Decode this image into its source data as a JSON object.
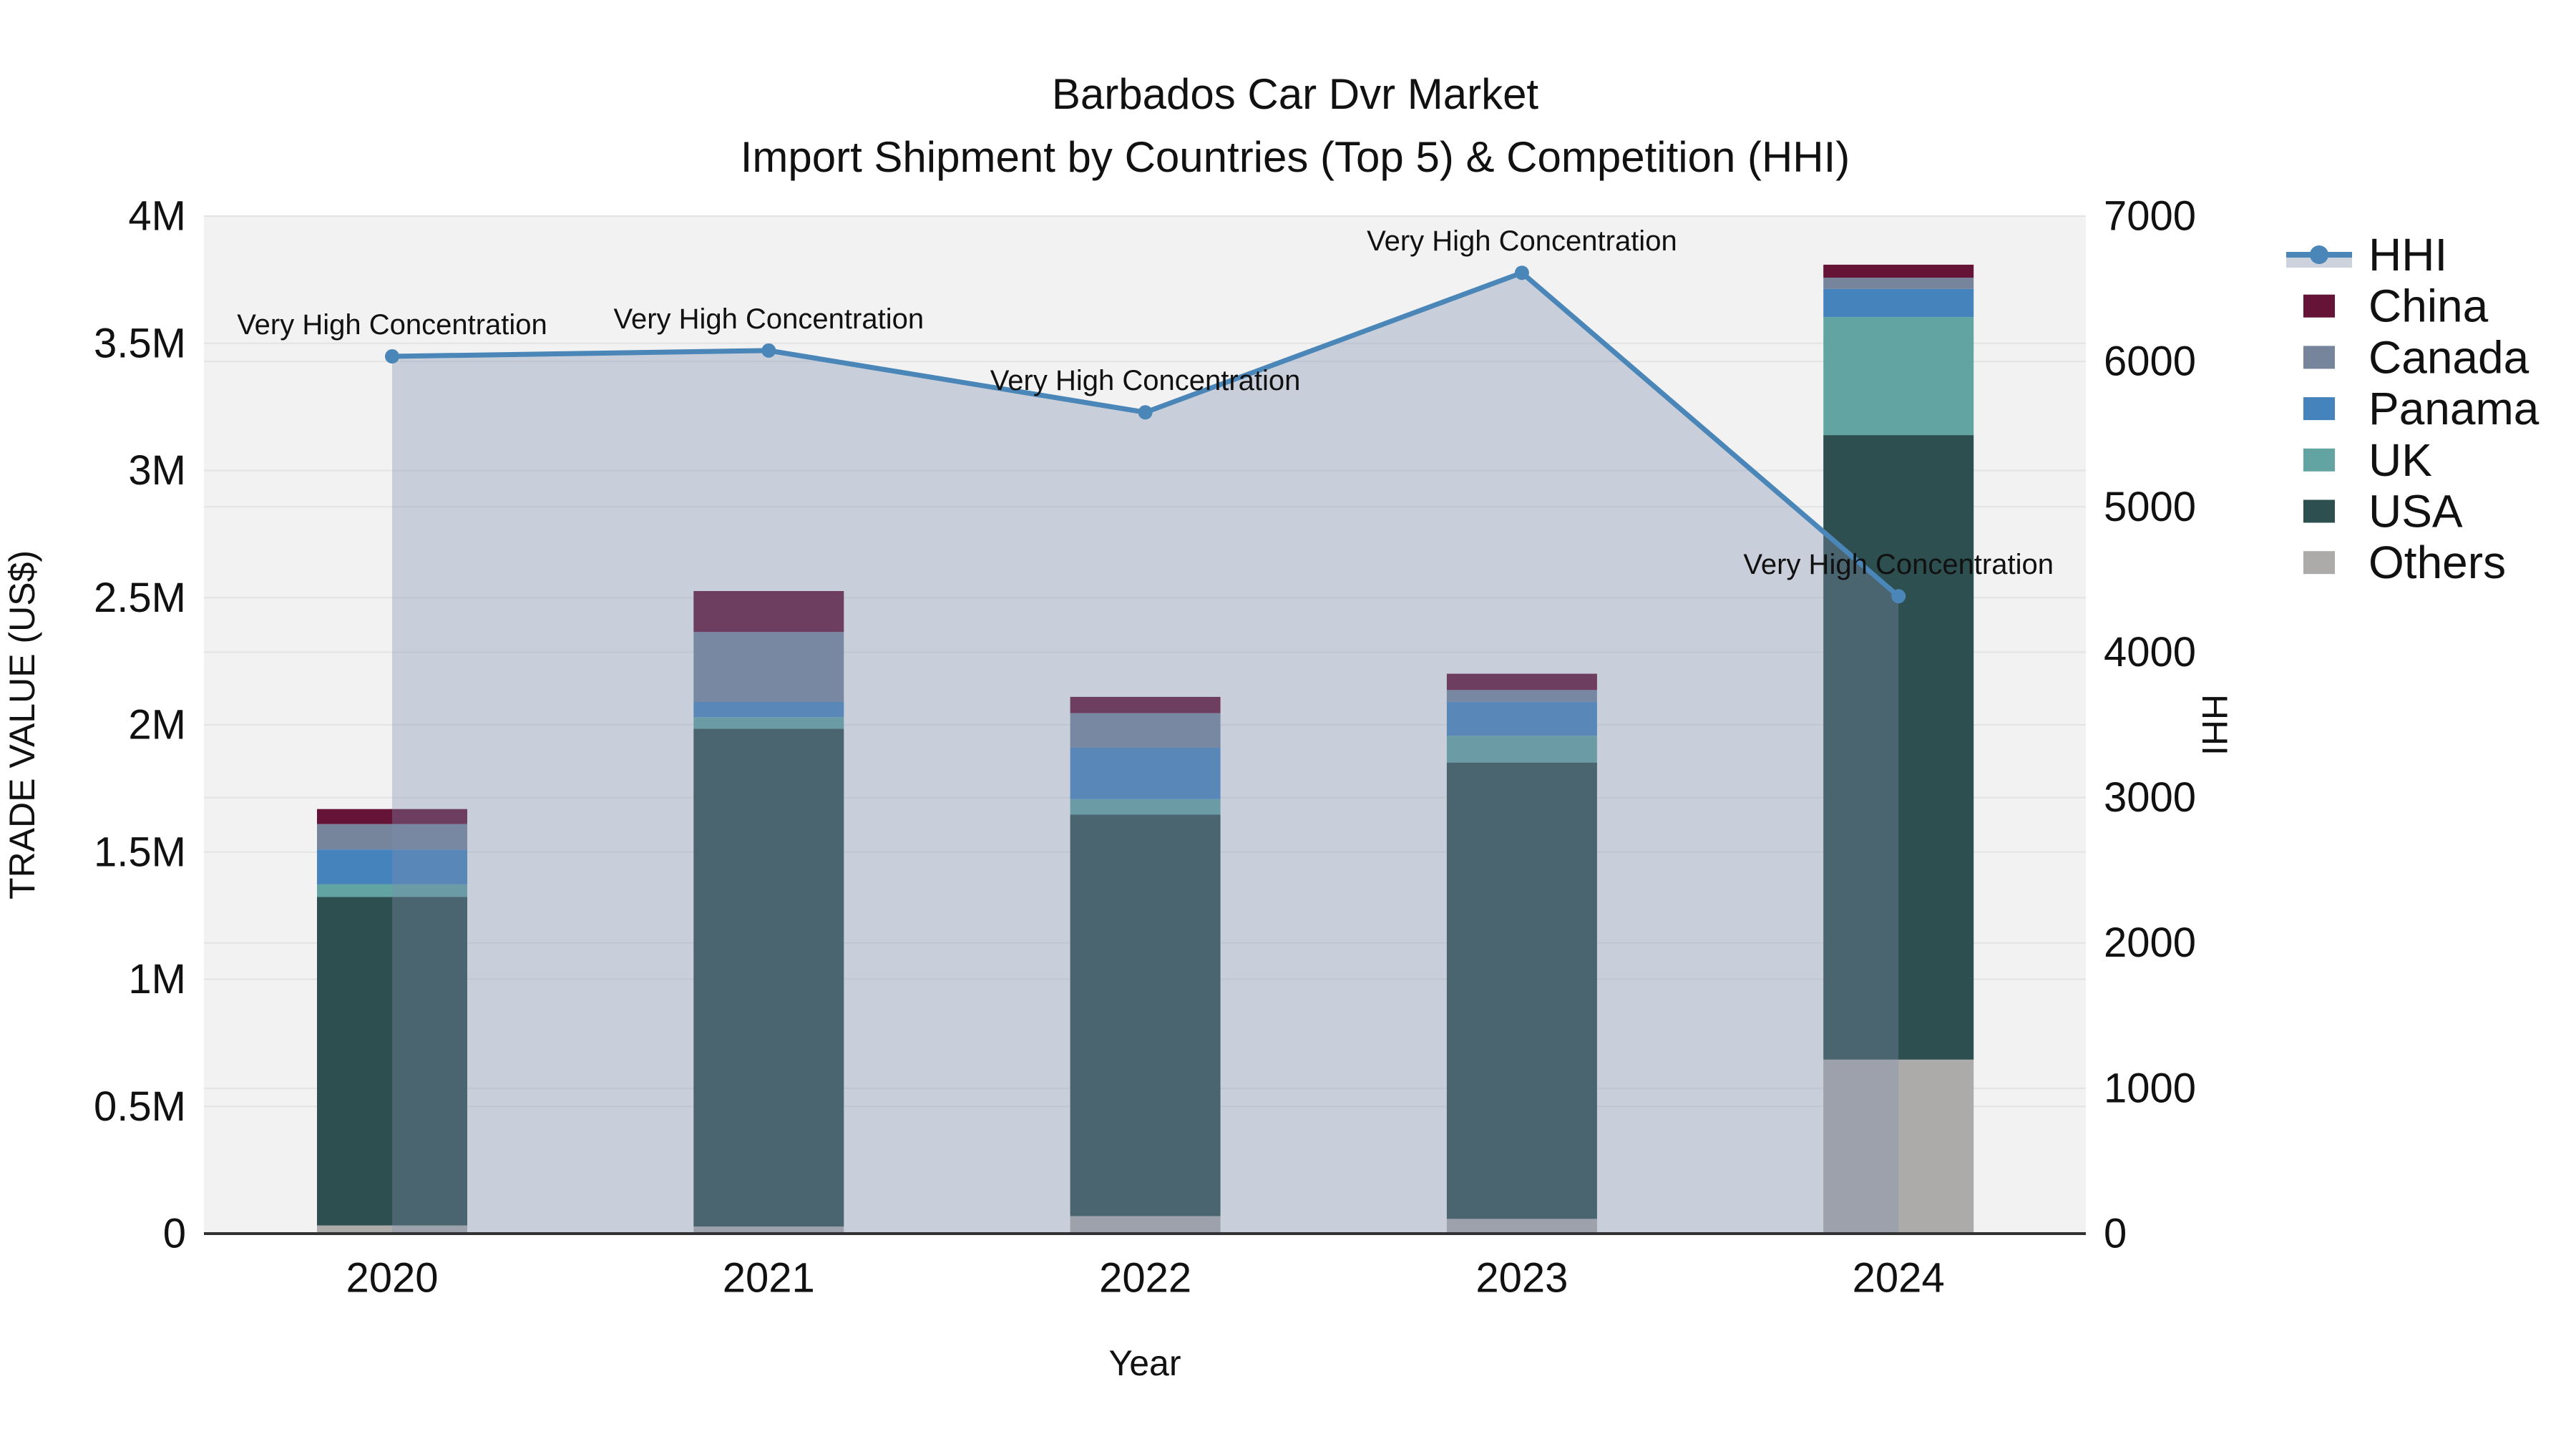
{
  "title": {
    "line1": "Barbados Car Dvr Market",
    "line2": "Import Shipment by Countries (Top 5) & Competition (HHI)"
  },
  "axes": {
    "x_title": "Year",
    "y_left_title": "TRADE VALUE (US$)",
    "y_right_title": "HHI",
    "y_left_ticks": [
      "0",
      "0.5M",
      "1M",
      "1.5M",
      "2M",
      "2.5M",
      "3M",
      "3.5M",
      "4M"
    ],
    "y_right_ticks": [
      "0",
      "1000",
      "2000",
      "3000",
      "4000",
      "5000",
      "6000",
      "7000"
    ]
  },
  "chart_data": {
    "type": "bar+line",
    "categories": [
      "2020",
      "2021",
      "2022",
      "2023",
      "2024"
    ],
    "bar_series": [
      {
        "name": "China",
        "color": "#651336",
        "values": [
          59000,
          161000,
          64000,
          64000,
          51000
        ]
      },
      {
        "name": "Canada",
        "color": "#76859B",
        "values": [
          100000,
          275000,
          136000,
          46000,
          44000
        ]
      },
      {
        "name": "Panama",
        "color": "#4583BD",
        "values": [
          137000,
          60000,
          202000,
          134000,
          111000
        ]
      },
      {
        "name": "UK",
        "color": "#61A4A1",
        "values": [
          49000,
          45000,
          61000,
          105000,
          464000
        ]
      },
      {
        "name": "USA",
        "color": "#2E4F4F",
        "values": [
          1292000,
          1957000,
          1578000,
          1794000,
          2455000
        ]
      },
      {
        "name": "Others",
        "color": "#ADABA9",
        "values": [
          32000,
          28000,
          69000,
          58000,
          684000
        ]
      }
    ],
    "stack_order_bottom_to_top": [
      "Others",
      "USA",
      "UK",
      "Panama",
      "Canada",
      "China"
    ],
    "line_series": {
      "name": "HHI",
      "color": "#4A86B8",
      "fill_color": "rgba(125,143,174,0.35)",
      "values": [
        6035,
        6075,
        5650,
        6610,
        4385
      ]
    },
    "annotations": [
      "Very High Concentration",
      "Very High Concentration",
      "Very High Concentration",
      "Very High Concentration",
      "Very High Concentration"
    ],
    "bar_totals": [
      1669000,
      2526000,
      2110000,
      2201000,
      3809000
    ],
    "y_left": {
      "min": 0,
      "max": 4000000,
      "step": 500000
    },
    "y_right": {
      "min": 0,
      "max": 7000,
      "step": 1000
    },
    "grid": true,
    "legend_position": "right"
  },
  "colors": {
    "plot_bg": "#F2F2F2",
    "grid": "#E3E3E3",
    "axis_line": "#323232",
    "text": "#111111"
  }
}
